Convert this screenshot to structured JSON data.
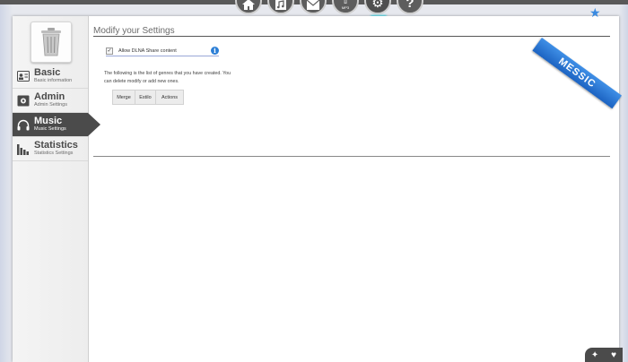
{
  "sidebar": {
    "items": [
      {
        "title": "Basic",
        "subtitle": "Basic information"
      },
      {
        "title": "Admin",
        "subtitle": "Admin Settings"
      },
      {
        "title": "Music",
        "subtitle": "Music Settings"
      },
      {
        "title": "Statistics",
        "subtitle": "Statistics Settings"
      }
    ],
    "active_index": 2
  },
  "main": {
    "title": "Modify your Settings",
    "dlna_label": "Allow DLNA Share content",
    "dlna_checked": true,
    "description": "The following is the list of genres that you have created. You can delete modify or add new ones.",
    "table_headers": [
      "Merge",
      "Estilo",
      "Actions"
    ]
  },
  "ribbon": {
    "label": "MESSIC"
  },
  "nav_icons": [
    "home-icon",
    "music-library-icon",
    "inbox-icon",
    "upload-mp3-icon",
    "settings-gear-icon",
    "help-icon"
  ],
  "nav_mp3_label": "MP3",
  "colors": {
    "accent_blue": "#2c7fd6",
    "active_menu": "#4b4b4b",
    "nav_glow": "#3fe0f0"
  }
}
